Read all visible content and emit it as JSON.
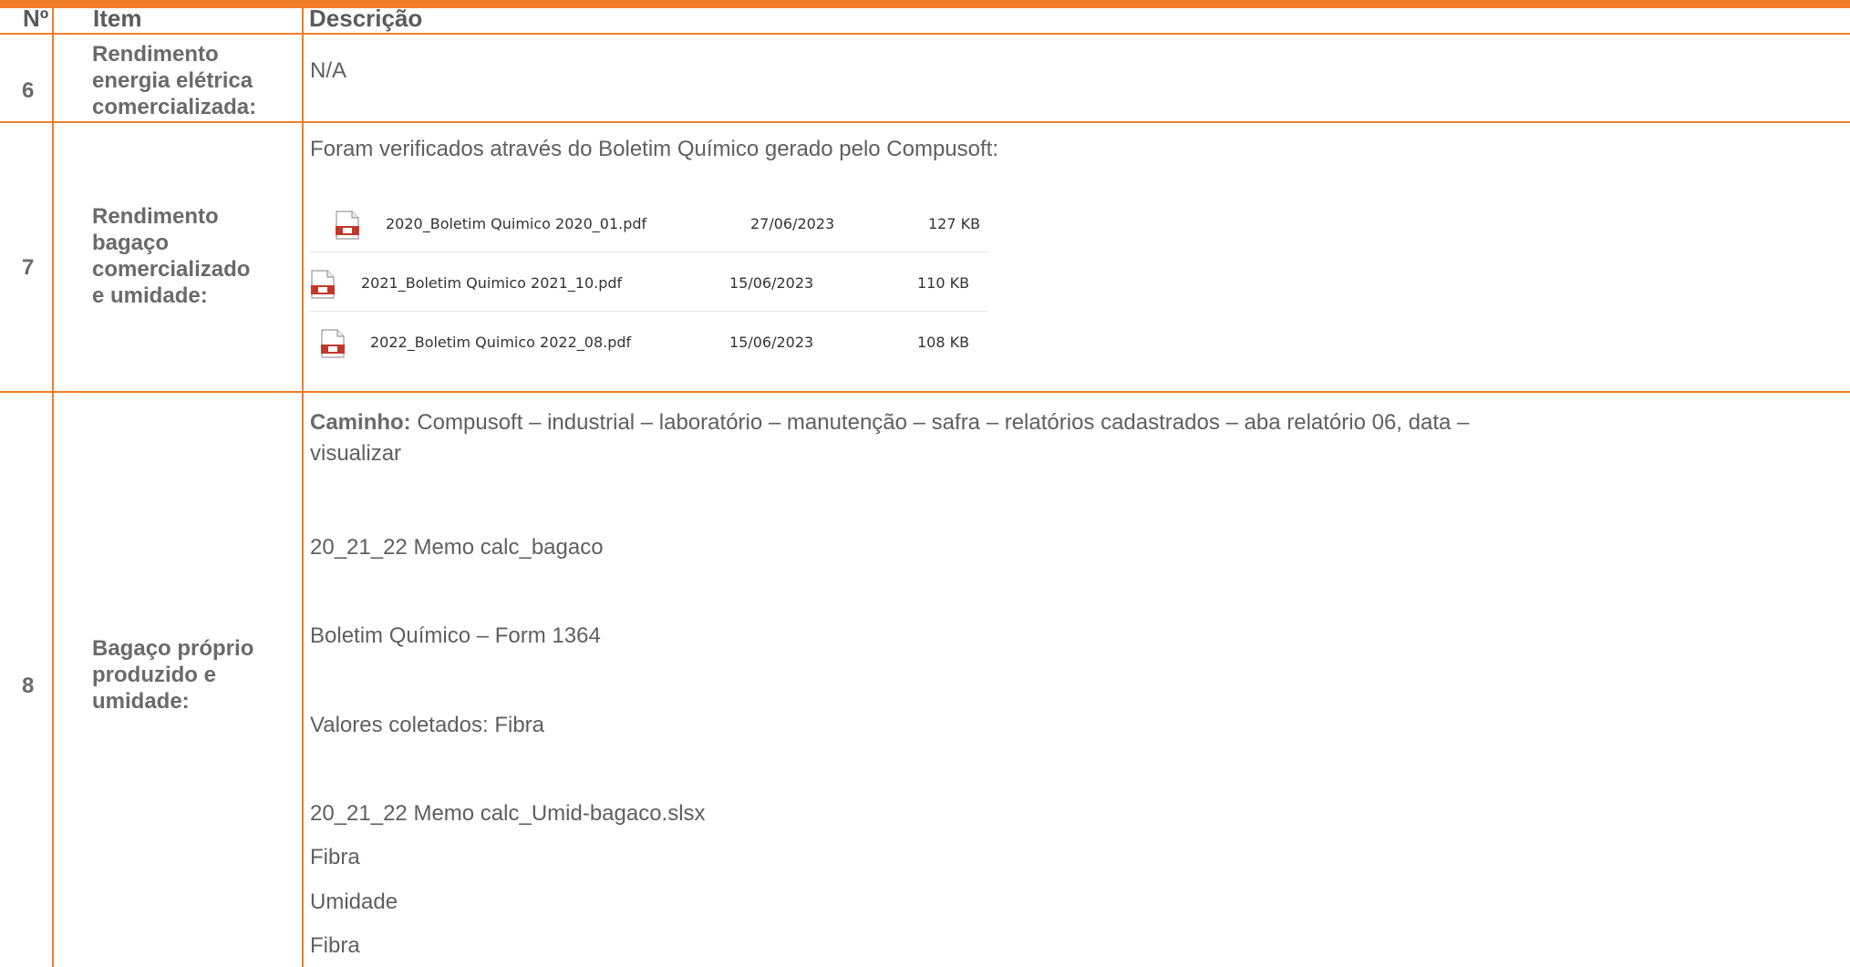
{
  "header": {
    "num": "Nº",
    "item": "Item",
    "desc": "Descrição"
  },
  "rows": [
    {
      "num": "6",
      "item_lines": [
        "Rendimento",
        "energia elétrica",
        "comercializada:"
      ],
      "desc": "N/A"
    },
    {
      "num": "7",
      "item_lines": [
        "Rendimento",
        "bagaço",
        "comercializado",
        "e umidade:"
      ],
      "desc_intro": "Foram verificados através do Boletim Químico gerado pelo Compusoft:",
      "files": [
        {
          "name": "2020_Boletim Quimico 2020_01.pdf",
          "date": "27/06/2023",
          "size": "127 KB"
        },
        {
          "name": "2021_Boletim Quimico 2021_10.pdf",
          "date": "15/06/2023",
          "size": "110 KB"
        },
        {
          "name": "2022_Boletim Quimico 2022_08.pdf",
          "date": "15/06/2023",
          "size": "108 KB"
        }
      ]
    },
    {
      "num": "8",
      "item_lines": [
        "Bagaço próprio",
        "produzido e",
        "umidade:"
      ],
      "path_label": "Caminho:",
      "path_text": "Compusoft – industrial – laboratório – manutenção – safra – relatórios cadastrados – aba relatório 06, data –",
      "path_text_2": "visualizar",
      "lines": [
        "20_21_22 Memo calc_bagaco",
        "Boletim Químico – Form 1364",
        "Valores coletados: Fibra",
        "20_21_22 Memo calc_Umid-bagaco.slsx",
        "Fibra",
        "Umidade",
        "Fibra"
      ]
    }
  ],
  "colors": {
    "accent": "#f07d2a",
    "pdf_red": "#c0392b"
  }
}
